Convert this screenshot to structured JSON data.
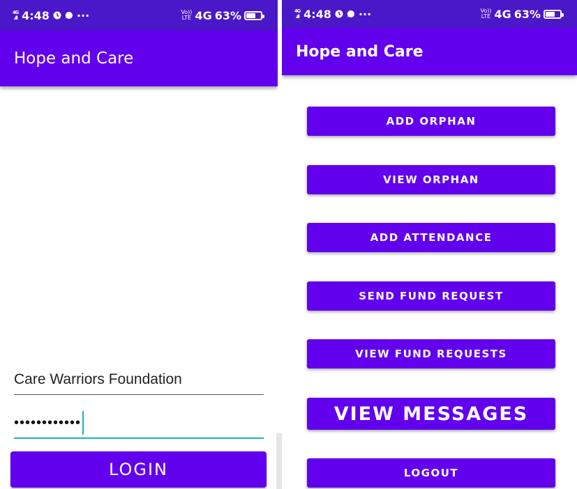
{
  "left": {
    "status": {
      "time": "4:48",
      "net_top": "4G",
      "net_bottom": ".ıll",
      "more": "···",
      "volte_top": "Vo))",
      "volte_bottom": "LTE",
      "net4g": "4G",
      "battery": "63%",
      "battery_level": 0.63
    },
    "app_title": "Hope and Care",
    "username_value": "Care Warriors Foundation",
    "password_value": "••••••••••••",
    "login_label": "LOGIN"
  },
  "right": {
    "status": {
      "time": "4:48",
      "net_top": "4G",
      "net_bottom": ".ıll",
      "more": "···",
      "volte_top": "Vo))",
      "volte_bottom": "LTE",
      "net4g": "4G",
      "battery": "63%",
      "battery_level": 0.63
    },
    "app_title": "Hope and Care",
    "buttons": [
      {
        "label": "ADD ORPHAN"
      },
      {
        "label": "VIEW ORPHAN"
      },
      {
        "label": "ADD ATTENDANCE"
      },
      {
        "label": "SEND FUND REQUEST"
      },
      {
        "label": "VIEW FUND REQUESTS"
      },
      {
        "label": "VIEW MESSAGES"
      },
      {
        "label": "LOGOUT"
      }
    ]
  },
  "colors": {
    "primary": "#6200ee",
    "status_bar": "#4a17c9",
    "accent": "#17b5b5"
  }
}
